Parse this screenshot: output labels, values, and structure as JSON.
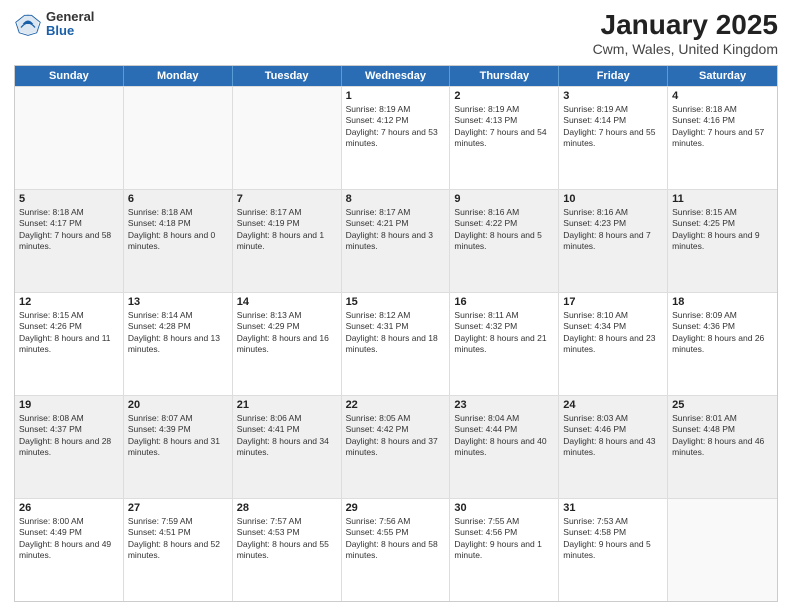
{
  "logo": {
    "general": "General",
    "blue": "Blue"
  },
  "title": "January 2025",
  "subtitle": "Cwm, Wales, United Kingdom",
  "days_of_week": [
    "Sunday",
    "Monday",
    "Tuesday",
    "Wednesday",
    "Thursday",
    "Friday",
    "Saturday"
  ],
  "weeks": [
    [
      {
        "day": "",
        "sunrise": "",
        "sunset": "",
        "daylight": "",
        "empty": true
      },
      {
        "day": "",
        "sunrise": "",
        "sunset": "",
        "daylight": "",
        "empty": true
      },
      {
        "day": "",
        "sunrise": "",
        "sunset": "",
        "daylight": "",
        "empty": true
      },
      {
        "day": "1",
        "sunrise": "Sunrise: 8:19 AM",
        "sunset": "Sunset: 4:12 PM",
        "daylight": "Daylight: 7 hours and 53 minutes."
      },
      {
        "day": "2",
        "sunrise": "Sunrise: 8:19 AM",
        "sunset": "Sunset: 4:13 PM",
        "daylight": "Daylight: 7 hours and 54 minutes."
      },
      {
        "day": "3",
        "sunrise": "Sunrise: 8:19 AM",
        "sunset": "Sunset: 4:14 PM",
        "daylight": "Daylight: 7 hours and 55 minutes."
      },
      {
        "day": "4",
        "sunrise": "Sunrise: 8:18 AM",
        "sunset": "Sunset: 4:16 PM",
        "daylight": "Daylight: 7 hours and 57 minutes."
      }
    ],
    [
      {
        "day": "5",
        "sunrise": "Sunrise: 8:18 AM",
        "sunset": "Sunset: 4:17 PM",
        "daylight": "Daylight: 7 hours and 58 minutes."
      },
      {
        "day": "6",
        "sunrise": "Sunrise: 8:18 AM",
        "sunset": "Sunset: 4:18 PM",
        "daylight": "Daylight: 8 hours and 0 minutes."
      },
      {
        "day": "7",
        "sunrise": "Sunrise: 8:17 AM",
        "sunset": "Sunset: 4:19 PM",
        "daylight": "Daylight: 8 hours and 1 minute."
      },
      {
        "day": "8",
        "sunrise": "Sunrise: 8:17 AM",
        "sunset": "Sunset: 4:21 PM",
        "daylight": "Daylight: 8 hours and 3 minutes."
      },
      {
        "day": "9",
        "sunrise": "Sunrise: 8:16 AM",
        "sunset": "Sunset: 4:22 PM",
        "daylight": "Daylight: 8 hours and 5 minutes."
      },
      {
        "day": "10",
        "sunrise": "Sunrise: 8:16 AM",
        "sunset": "Sunset: 4:23 PM",
        "daylight": "Daylight: 8 hours and 7 minutes."
      },
      {
        "day": "11",
        "sunrise": "Sunrise: 8:15 AM",
        "sunset": "Sunset: 4:25 PM",
        "daylight": "Daylight: 8 hours and 9 minutes."
      }
    ],
    [
      {
        "day": "12",
        "sunrise": "Sunrise: 8:15 AM",
        "sunset": "Sunset: 4:26 PM",
        "daylight": "Daylight: 8 hours and 11 minutes."
      },
      {
        "day": "13",
        "sunrise": "Sunrise: 8:14 AM",
        "sunset": "Sunset: 4:28 PM",
        "daylight": "Daylight: 8 hours and 13 minutes."
      },
      {
        "day": "14",
        "sunrise": "Sunrise: 8:13 AM",
        "sunset": "Sunset: 4:29 PM",
        "daylight": "Daylight: 8 hours and 16 minutes."
      },
      {
        "day": "15",
        "sunrise": "Sunrise: 8:12 AM",
        "sunset": "Sunset: 4:31 PM",
        "daylight": "Daylight: 8 hours and 18 minutes."
      },
      {
        "day": "16",
        "sunrise": "Sunrise: 8:11 AM",
        "sunset": "Sunset: 4:32 PM",
        "daylight": "Daylight: 8 hours and 21 minutes."
      },
      {
        "day": "17",
        "sunrise": "Sunrise: 8:10 AM",
        "sunset": "Sunset: 4:34 PM",
        "daylight": "Daylight: 8 hours and 23 minutes."
      },
      {
        "day": "18",
        "sunrise": "Sunrise: 8:09 AM",
        "sunset": "Sunset: 4:36 PM",
        "daylight": "Daylight: 8 hours and 26 minutes."
      }
    ],
    [
      {
        "day": "19",
        "sunrise": "Sunrise: 8:08 AM",
        "sunset": "Sunset: 4:37 PM",
        "daylight": "Daylight: 8 hours and 28 minutes."
      },
      {
        "day": "20",
        "sunrise": "Sunrise: 8:07 AM",
        "sunset": "Sunset: 4:39 PM",
        "daylight": "Daylight: 8 hours and 31 minutes."
      },
      {
        "day": "21",
        "sunrise": "Sunrise: 8:06 AM",
        "sunset": "Sunset: 4:41 PM",
        "daylight": "Daylight: 8 hours and 34 minutes."
      },
      {
        "day": "22",
        "sunrise": "Sunrise: 8:05 AM",
        "sunset": "Sunset: 4:42 PM",
        "daylight": "Daylight: 8 hours and 37 minutes."
      },
      {
        "day": "23",
        "sunrise": "Sunrise: 8:04 AM",
        "sunset": "Sunset: 4:44 PM",
        "daylight": "Daylight: 8 hours and 40 minutes."
      },
      {
        "day": "24",
        "sunrise": "Sunrise: 8:03 AM",
        "sunset": "Sunset: 4:46 PM",
        "daylight": "Daylight: 8 hours and 43 minutes."
      },
      {
        "day": "25",
        "sunrise": "Sunrise: 8:01 AM",
        "sunset": "Sunset: 4:48 PM",
        "daylight": "Daylight: 8 hours and 46 minutes."
      }
    ],
    [
      {
        "day": "26",
        "sunrise": "Sunrise: 8:00 AM",
        "sunset": "Sunset: 4:49 PM",
        "daylight": "Daylight: 8 hours and 49 minutes."
      },
      {
        "day": "27",
        "sunrise": "Sunrise: 7:59 AM",
        "sunset": "Sunset: 4:51 PM",
        "daylight": "Daylight: 8 hours and 52 minutes."
      },
      {
        "day": "28",
        "sunrise": "Sunrise: 7:57 AM",
        "sunset": "Sunset: 4:53 PM",
        "daylight": "Daylight: 8 hours and 55 minutes."
      },
      {
        "day": "29",
        "sunrise": "Sunrise: 7:56 AM",
        "sunset": "Sunset: 4:55 PM",
        "daylight": "Daylight: 8 hours and 58 minutes."
      },
      {
        "day": "30",
        "sunrise": "Sunrise: 7:55 AM",
        "sunset": "Sunset: 4:56 PM",
        "daylight": "Daylight: 9 hours and 1 minute."
      },
      {
        "day": "31",
        "sunrise": "Sunrise: 7:53 AM",
        "sunset": "Sunset: 4:58 PM",
        "daylight": "Daylight: 9 hours and 5 minutes."
      },
      {
        "day": "",
        "sunrise": "",
        "sunset": "",
        "daylight": "",
        "empty": true
      }
    ]
  ]
}
